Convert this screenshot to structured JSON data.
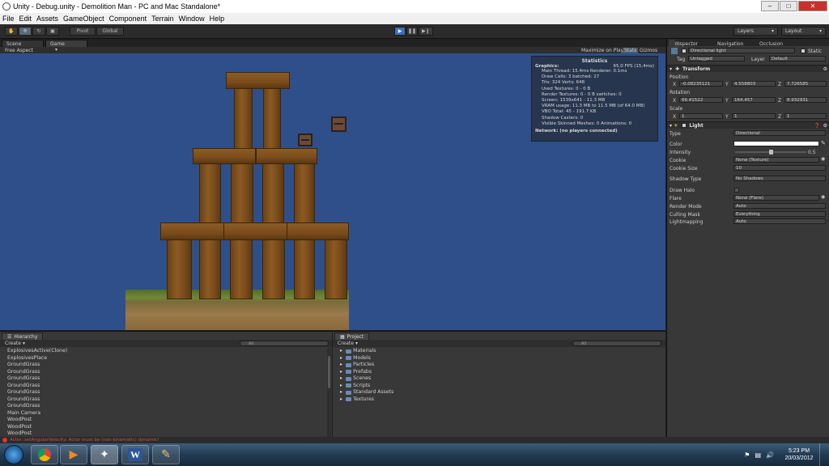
{
  "window": {
    "title": "Unity - Debug.unity - Demolition Man - PC and Mac Standalone*"
  },
  "menu": [
    "File",
    "Edit",
    "Assets",
    "GameObject",
    "Component",
    "Terrain",
    "Window",
    "Help"
  ],
  "toolbar": {
    "pivot_label": "Pivot",
    "global_label": "Global",
    "layers_label": "Layers",
    "layout_label": "Layout"
  },
  "game_view": {
    "tabs": [
      "Scene",
      "Game"
    ],
    "aspect": "Free Aspect",
    "buttons": [
      "Maximize on Play",
      "Stats",
      "Gizmos"
    ]
  },
  "stats": {
    "title": "Statistics",
    "graphics_label": "Graphics:",
    "fps": "65.0 FPS (15.4ms)",
    "lines": [
      "Main Thread: 15.4ms  Renderer: 0.1ms",
      "Draw Calls: 3   batched: 27",
      "Tris: 324  Verts: 648",
      "Used Textures: 0 - 0 B",
      "Render Textures: 0 - 0 B   switches: 0",
      "Screen: 1539x641 - 11.3 MB",
      "VRAM usage: 11.3 MB to 11.5 MB (of 64.0 MB)",
      "VBO Total: 45 - 191.7 KB",
      "Shadow Casters: 0",
      "Visible Skinned Meshes: 0        Animations: 0"
    ],
    "network": "Network: (no players connected)"
  },
  "hierarchy": {
    "tab": "Hierarchy",
    "create": "Create",
    "search": "All",
    "items": [
      "ExplosivesActive(Clone)",
      "ExplosivesPlace",
      "GroundGrass",
      "GroundGrass",
      "GroundGrass",
      "GroundGrass",
      "GroundGrass",
      "GroundGrass",
      "GroundGrass",
      "Main Camera",
      "WoodPost",
      "WoodPost",
      "WoodPost"
    ]
  },
  "project": {
    "tab": "Project",
    "create": "Create",
    "search": "All",
    "folders": [
      "Materials",
      "Models",
      "Particles",
      "Prefabs",
      "Scenes",
      "Scripts",
      "Standard Assets",
      "Textures"
    ]
  },
  "inspector": {
    "tabs": [
      "Inspector",
      "Navigation",
      "Occlusion"
    ],
    "object_name": "Directional light",
    "static_label": "Static",
    "tag_label": "Tag",
    "tag_value": "Untagged",
    "layer_label": "Layer",
    "layer_value": "Default",
    "transform": {
      "title": "Transform",
      "position_label": "Position",
      "position": {
        "x": "-0.08235121",
        "y": "4.558803",
        "z": "7.726585"
      },
      "rotation_label": "Rotation",
      "rotation": {
        "x": "66.41522",
        "y": "164.457",
        "z": "8.932931"
      },
      "scale_label": "Scale",
      "scale": {
        "x": "1",
        "y": "1",
        "z": "1"
      }
    },
    "light": {
      "title": "Light",
      "type_label": "Type",
      "type_value": "Directional",
      "color_label": "Color",
      "intensity_label": "Intensity",
      "intensity_value": "0.5",
      "intensity_fraction": 0.5,
      "cookie_label": "Cookie",
      "cookie_value": "None (Texture)",
      "cookie_size_label": "Cookie Size",
      "cookie_size_value": "10",
      "shadow_type_label": "Shadow Type",
      "shadow_type_value": "No Shadows",
      "draw_halo_label": "Draw Halo",
      "flare_label": "Flare",
      "flare_value": "None (Flare)",
      "render_mode_label": "Render Mode",
      "render_mode_value": "Auto",
      "culling_mask_label": "Culling Mask",
      "culling_mask_value": "Everything",
      "lightmapping_label": "Lightmapping",
      "lightmapping_value": "Auto"
    }
  },
  "status": {
    "message": "Actor::setAngularVelocity: Actor must be (non-kinematic) dynamic!"
  },
  "taskbar": {
    "apps": [
      "chrome-icon",
      "media-player-icon",
      "unity-icon",
      "word-icon",
      "paint-icon"
    ],
    "time": "5:23 PM",
    "date": "20/03/2012"
  },
  "colors": {
    "sky": "#2f4f8a",
    "editor_bg": "#383838",
    "play_accent": "#3f6fb8",
    "error": "#d05050"
  }
}
